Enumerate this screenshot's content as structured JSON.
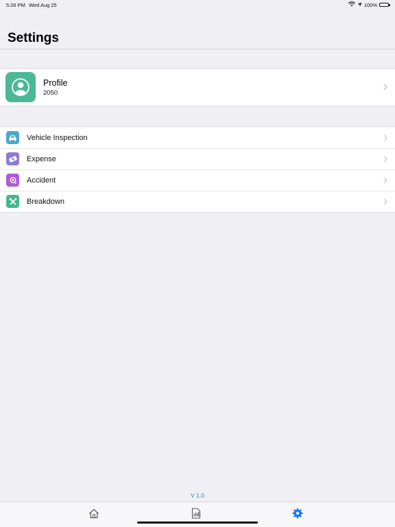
{
  "status_bar": {
    "time": "5:26 PM",
    "date": "Wed Aug 25",
    "battery": "100%"
  },
  "page": {
    "title": "Settings"
  },
  "profile": {
    "name": "Profile",
    "id": "2050",
    "icon": "user-avatar-icon",
    "color": "#4cb896"
  },
  "menu": {
    "items": [
      {
        "label": "Vehicle Inspection",
        "icon": "car-icon",
        "color": "#4aa8c8"
      },
      {
        "label": "Expense",
        "icon": "money-icon",
        "color": "#8b7ad8"
      },
      {
        "label": "Accident",
        "icon": "accident-icon",
        "color": "#b15ad6"
      },
      {
        "label": "Breakdown",
        "icon": "tools-icon",
        "color": "#3fb98a"
      }
    ]
  },
  "footer": {
    "version": "V 1.0"
  },
  "tab_bar": {
    "active_color": "#1a73e8",
    "tabs": [
      {
        "icon": "home-icon"
      },
      {
        "icon": "reports-icon"
      },
      {
        "icon": "gear-icon",
        "active": true
      }
    ]
  }
}
